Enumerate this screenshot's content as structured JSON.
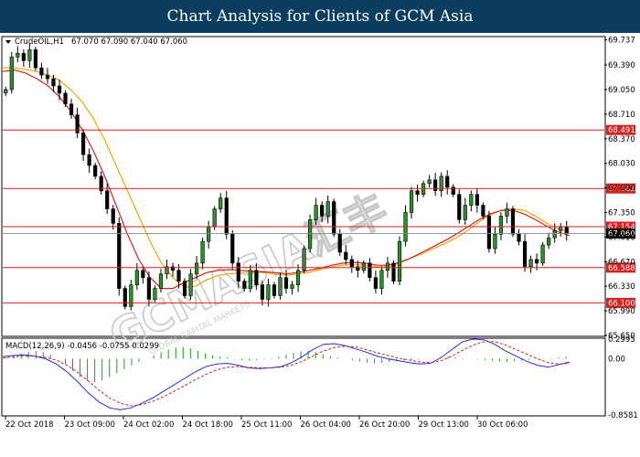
{
  "banner": {
    "title": "Chart Analysis for Clients of GCM Asia"
  },
  "header": {
    "symbol": "CrudeOIL,H1",
    "ohlc": "67.070 67.090 67.040 67.060"
  },
  "watermark": {
    "brand": "GCMASIA汇丰",
    "sub": "GLOBAL CAPITAL MARKETS"
  },
  "chart_data": [
    {
      "type": "candlestick",
      "ylim": [
        65.65,
        69.77
      ],
      "y_ticks": [
        "69.737",
        "69.390",
        "69.050",
        "68.710",
        "68.370",
        "68.030",
        "67.690",
        "67.350",
        "67.010",
        "66.670",
        "66.330",
        "65.990",
        "65.650"
      ],
      "x_ticks": [
        "22 Oct 2018",
        "23 Oct 09:00",
        "24 Oct 02:00",
        "24 Oct 18:00",
        "25 Oct 11:00",
        "26 Oct 04:00",
        "26 Oct 20:00",
        "29 Oct 13:00",
        "30 Oct 06:00"
      ],
      "horizontal_levels": [
        {
          "value": 68.491,
          "label": "68.491"
        },
        {
          "value": 67.682,
          "label": "67.682"
        },
        {
          "value": 67.154,
          "label": "67.154"
        },
        {
          "value": 66.588,
          "label": "66.588"
        },
        {
          "value": 66.1,
          "label": "66.100"
        }
      ],
      "current_price": {
        "value": 67.06,
        "label": "67.060"
      },
      "closes": [
        69.05,
        69.5,
        69.55,
        69.45,
        69.6,
        69.35,
        69.25,
        69.2,
        69.1,
        69.0,
        68.85,
        68.7,
        68.45,
        68.15,
        68.0,
        67.85,
        67.65,
        67.4,
        67.2,
        66.3,
        66.05,
        66.35,
        66.55,
        66.45,
        66.15,
        66.3,
        66.5,
        66.6,
        66.55,
        66.4,
        66.2,
        66.5,
        66.65,
        66.95,
        67.15,
        67.4,
        67.55,
        67.05,
        66.65,
        66.4,
        66.3,
        66.55,
        66.35,
        66.15,
        66.35,
        66.2,
        66.45,
        66.3,
        66.35,
        66.55,
        66.85,
        67.25,
        67.45,
        67.3,
        67.5,
        67.05,
        66.8,
        66.7,
        66.6,
        66.55,
        66.65,
        66.45,
        66.3,
        66.55,
        66.65,
        66.4,
        66.95,
        67.35,
        67.65,
        67.6,
        67.75,
        67.8,
        67.65,
        67.85,
        67.7,
        67.6,
        67.25,
        67.45,
        67.6,
        67.45,
        67.3,
        66.85,
        67.05,
        67.3,
        67.4,
        67.05,
        66.95,
        66.6,
        66.7,
        66.65,
        66.9,
        67.0,
        67.1,
        67.15,
        67.06
      ],
      "ma_series": [
        {
          "name": "",
          "color": "#f0a500",
          "values": [
            69.35,
            69.35,
            69.33,
            69.3,
            69.25,
            69.18,
            69.05,
            68.88,
            68.65,
            68.35,
            68.0,
            67.65,
            67.3,
            66.95,
            66.65,
            66.45,
            66.32,
            66.33,
            66.42,
            66.48,
            66.5,
            66.52,
            66.52,
            66.52,
            66.5,
            66.48,
            66.5,
            66.52,
            66.56,
            66.6,
            66.62,
            66.63,
            66.62,
            66.6,
            66.6,
            66.65,
            66.72,
            66.78,
            66.85,
            66.92,
            67.0,
            67.1,
            67.22,
            67.32,
            67.38,
            67.4,
            67.38,
            67.3,
            67.2,
            67.12,
            67.08
          ]
        },
        {
          "name": "",
          "color": "#d42020",
          "values": [
            69.3,
            69.32,
            69.28,
            69.2,
            69.1,
            68.95,
            68.75,
            68.5,
            68.2,
            67.85,
            67.45,
            67.05,
            66.7,
            66.45,
            66.3,
            66.3,
            66.38,
            66.45,
            66.52,
            66.55,
            66.56,
            66.55,
            66.54,
            66.53,
            66.52,
            66.5,
            66.52,
            66.55,
            66.58,
            66.62,
            66.65,
            66.66,
            66.65,
            66.62,
            66.62,
            66.66,
            66.72,
            66.8,
            66.88,
            66.96,
            67.05,
            67.15,
            67.25,
            67.33,
            67.38,
            67.38,
            67.33,
            67.25,
            67.16,
            67.08,
            67.03
          ]
        }
      ]
    },
    {
      "type": "macd",
      "title": "MACD(12,26,9) -0.0456 -0.0755 0.0299",
      "ylim": [
        -0.8581,
        0.2995
      ],
      "y_ticks": [
        "0.2995",
        "0.00",
        "-0.8581"
      ],
      "histogram": [
        0.02,
        0.05,
        0.08,
        0.1,
        0.12,
        0.1,
        0.06,
        0.0,
        -0.08,
        -0.18,
        -0.28,
        -0.34,
        -0.36,
        -0.33,
        -0.28,
        -0.22,
        -0.16,
        -0.1,
        -0.05,
        0.0,
        0.05,
        0.1,
        0.14,
        0.17,
        0.18,
        0.16,
        0.12,
        0.08,
        0.05,
        0.03,
        0.02,
        0.0,
        -0.02,
        -0.03,
        -0.02,
        -0.01,
        0.01,
        0.03,
        0.06,
        0.09,
        0.11,
        0.12,
        0.1,
        0.07,
        0.04,
        0.02,
        0.0,
        -0.02,
        -0.04,
        -0.06,
        -0.07,
        -0.06,
        -0.05,
        -0.04,
        -0.03,
        -0.02,
        -0.01,
        0.0,
        0.01,
        0.02,
        0.03,
        0.02,
        0.01,
        0.0,
        -0.01,
        -0.02,
        -0.03,
        -0.04,
        -0.05,
        -0.04,
        -0.03,
        -0.02,
        -0.01,
        0.0,
        0.01,
        0.02,
        0.03
      ],
      "macd": [
        0.03,
        0.05,
        0.06,
        0.04,
        0.0,
        -0.08,
        -0.2,
        -0.35,
        -0.52,
        -0.66,
        -0.75,
        -0.78,
        -0.75,
        -0.68,
        -0.6,
        -0.5,
        -0.4,
        -0.3,
        -0.2,
        -0.12,
        -0.08,
        -0.07,
        -0.1,
        -0.14,
        -0.15,
        -0.14,
        -0.12,
        -0.06,
        0.03,
        0.14,
        0.22,
        0.23,
        0.2,
        0.15,
        0.1,
        0.04,
        0.0,
        -0.03,
        -0.06,
        -0.08,
        -0.07,
        0.02,
        0.14,
        0.26,
        0.3,
        0.29,
        0.22,
        0.12,
        0.04,
        -0.04,
        -0.1,
        -0.13,
        -0.09,
        -0.05
      ],
      "signal": [
        0.01,
        0.03,
        0.04,
        0.04,
        0.02,
        -0.02,
        -0.1,
        -0.21,
        -0.34,
        -0.48,
        -0.6,
        -0.68,
        -0.72,
        -0.7,
        -0.65,
        -0.58,
        -0.5,
        -0.41,
        -0.32,
        -0.24,
        -0.17,
        -0.13,
        -0.12,
        -0.13,
        -0.14,
        -0.14,
        -0.13,
        -0.1,
        -0.04,
        0.04,
        0.12,
        0.17,
        0.19,
        0.18,
        0.14,
        0.09,
        0.05,
        0.01,
        -0.02,
        -0.05,
        -0.06,
        -0.03,
        0.04,
        0.13,
        0.21,
        0.26,
        0.26,
        0.21,
        0.14,
        0.07,
        0.0,
        -0.06,
        -0.08,
        -0.07
      ]
    }
  ]
}
